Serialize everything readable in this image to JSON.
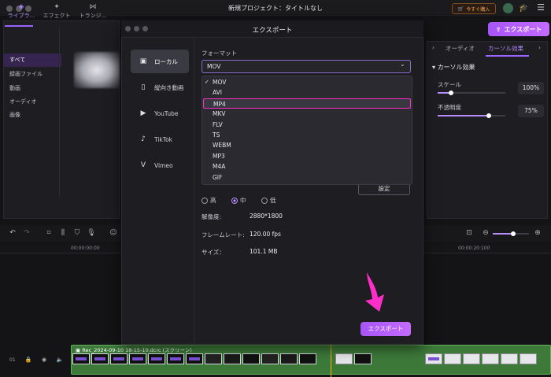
{
  "app": {
    "title": "新規プロジェクト：タイトルなし",
    "buy_label": "今すぐ購入",
    "export_label": "エクスポート",
    "accent_color": "#a855f7"
  },
  "left_panel": {
    "tabs": [
      "ライブラ...",
      "エフェクト",
      "トランジ..."
    ],
    "items": [
      "すべて",
      "録画ファイル",
      "動画",
      "オーディオ",
      "画像"
    ]
  },
  "right_panel": {
    "tabs": [
      "オーディオ",
      "カーソル効果"
    ],
    "section_title": "カーソル効果",
    "scale_label": "スケール",
    "scale_value": "100%",
    "scale_level": 0.2,
    "opacity_label": "不透明度",
    "opacity_value": "75%",
    "opacity_level": 0.75
  },
  "dialog": {
    "title": "エクスポート",
    "sidebar": [
      {
        "label": "ローカル",
        "icon": "folder-icon"
      },
      {
        "label": "縦向き動画",
        "icon": "phone-icon"
      },
      {
        "label": "YouTube",
        "icon": "youtube-icon"
      },
      {
        "label": "TikTok",
        "icon": "tiktok-icon"
      },
      {
        "label": "Vimeo",
        "icon": "vimeo-icon"
      }
    ],
    "format_label": "フォーマット",
    "format_value": "MOV",
    "format_options": [
      "MOV",
      "AVI",
      "MP4",
      "MKV",
      "FLV",
      "TS",
      "WEBM",
      "MP3",
      "M4A",
      "GIF"
    ],
    "selected_option": "MOV",
    "highlighted_option": "MP4",
    "settings_label": "設定",
    "quality": [
      "高",
      "中",
      "低"
    ],
    "quality_selected": "中",
    "resolution_label": "解像度:",
    "resolution_value": "2880*1800",
    "framerate_label": "フレームレート:",
    "framerate_value": "120.00 fps",
    "size_label": "サイズ：",
    "size_value": "101.1 MB",
    "export_label": "エクスポート",
    "highlight_color": "#ff2ec8"
  },
  "timeline": {
    "ruler": [
      "00:00:00:00",
      "00:00:20:100"
    ],
    "track_number": "01",
    "clip_title": "Rec_2024-09-10 18-15-10.dcrc (スクリーン)"
  }
}
